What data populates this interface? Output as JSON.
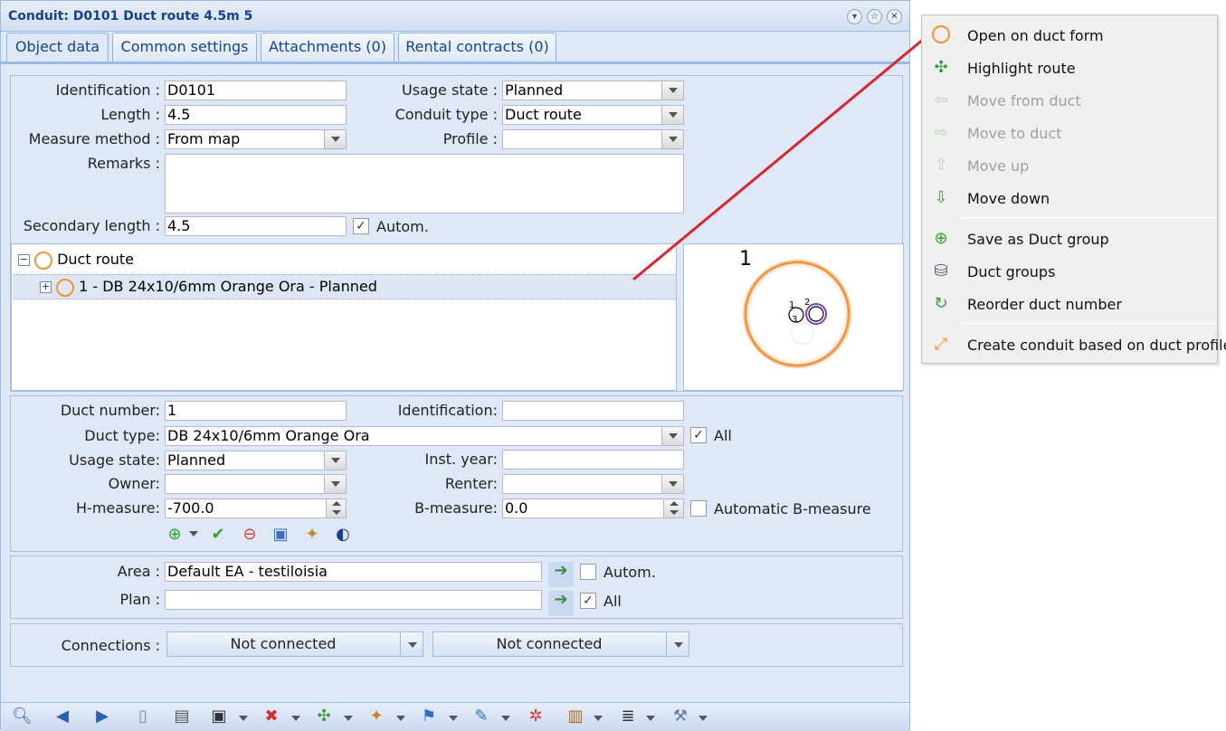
{
  "window": {
    "title": "Conduit: D0101 Duct route 4.5m 5",
    "tabs": [
      "Object data",
      "Common settings",
      "Attachments (0)",
      "Rental contracts (0)"
    ]
  },
  "main": {
    "identification_label": "Identification :",
    "identification_value": "D0101",
    "length_label": "Length :",
    "length_value": "4.5",
    "measure_method_label": "Measure method :",
    "measure_method_value": "From map",
    "remarks_label": "Remarks :",
    "remarks_value": "",
    "usage_state_label": "Usage state :",
    "usage_state_value": "Planned",
    "conduit_type_label": "Conduit type :",
    "conduit_type_value": "Duct route",
    "profile_label": "Profile :",
    "profile_value": "",
    "secondary_length_label": "Secondary length :",
    "secondary_length_value": "4.5",
    "autom_label": "Autom."
  },
  "tree": {
    "root_label": "Duct route",
    "child_label": "1 - DB 24x10/6mm Orange Ora - Planned"
  },
  "preview": {
    "number": "1",
    "sub_labels": [
      "1",
      "2",
      "3"
    ]
  },
  "duct": {
    "duct_number_label": "Duct number:",
    "duct_number_value": "1",
    "identification_label": "Identification:",
    "identification_value": "",
    "duct_type_label": "Duct type:",
    "duct_type_value": "DB 24x10/6mm Orange Ora",
    "all_label": "All",
    "usage_state_label": "Usage state:",
    "usage_state_value": "Planned",
    "inst_year_label": "Inst. year:",
    "inst_year_value": "",
    "owner_label": "Owner:",
    "owner_value": "",
    "renter_label": "Renter:",
    "renter_value": "",
    "h_measure_label": "H-measure:",
    "h_measure_value": "-700.0",
    "b_measure_label": "B-measure:",
    "b_measure_value": "0.0",
    "automatic_b_label": "Automatic B-measure"
  },
  "area": {
    "area_label": "Area :",
    "area_value": "Default EA - testiloisia",
    "autom_label": "Autom.",
    "plan_label": "Plan :",
    "plan_value": "",
    "all_label": "All"
  },
  "connections": {
    "label": "Connections :",
    "first": "Not connected",
    "second": "Not connected"
  },
  "context_menu": {
    "items": [
      {
        "label": "Open on duct form",
        "icon": "orange-ring-icon",
        "disabled": false
      },
      {
        "label": "Highlight route",
        "icon": "highlight-arrows-icon",
        "disabled": false
      },
      {
        "label": "Move from duct",
        "icon": "move-from-icon",
        "disabled": true
      },
      {
        "label": "Move to duct",
        "icon": "move-to-icon",
        "disabled": true
      },
      {
        "label": "Move up",
        "icon": "arrow-up-icon",
        "disabled": true
      },
      {
        "label": "Move down",
        "icon": "arrow-down-icon",
        "disabled": false
      },
      {
        "label": "Save as Duct group",
        "icon": "green-plus-icon",
        "disabled": false
      },
      {
        "label": "Duct groups",
        "icon": "duct-groups-icon",
        "disabled": false
      },
      {
        "label": "Reorder duct number",
        "icon": "reorder-icon",
        "disabled": false
      },
      {
        "label": "Create conduit based on duct profile",
        "icon": "ruler-icon",
        "disabled": false
      }
    ]
  },
  "colors": {
    "accent": "#15428b",
    "panel": "#dfe8f6",
    "duct_orange": "#f39234",
    "annotation_line": "#d7262e"
  }
}
